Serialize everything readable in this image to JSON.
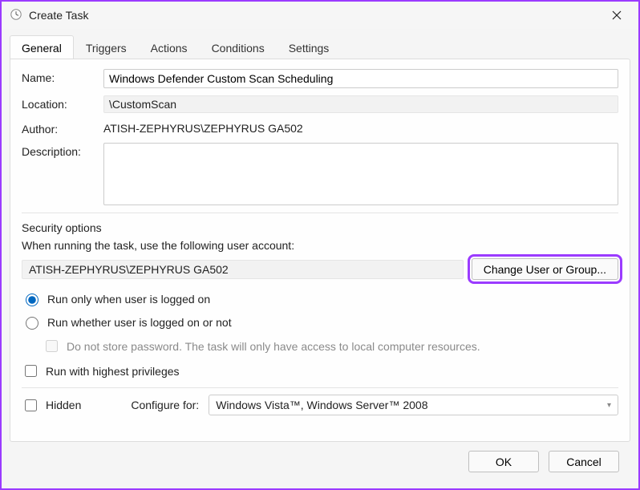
{
  "window": {
    "title": "Create Task"
  },
  "tabs": {
    "general": "General",
    "triggers": "Triggers",
    "actions": "Actions",
    "conditions": "Conditions",
    "settings": "Settings"
  },
  "form": {
    "name_label": "Name:",
    "name_value": "Windows Defender Custom Scan Scheduling",
    "location_label": "Location:",
    "location_value": "\\CustomScan",
    "author_label": "Author:",
    "author_value": "ATISH-ZEPHYRUS\\ZEPHYRUS GA502",
    "description_label": "Description:",
    "description_value": ""
  },
  "security": {
    "section_title": "Security options",
    "account_label": "When running the task, use the following user account:",
    "account_value": "ATISH-ZEPHYRUS\\ZEPHYRUS GA502",
    "change_user_btn": "Change User or Group...",
    "run_logged_on": "Run only when user is logged on",
    "run_whether": "Run whether user is logged on or not",
    "no_store_password": "Do not store password.  The task will only have access to local computer resources.",
    "highest_privileges": "Run with highest privileges"
  },
  "bottom": {
    "hidden_label": "Hidden",
    "configure_label": "Configure for:",
    "configure_value": "Windows Vista™, Windows Server™ 2008"
  },
  "buttons": {
    "ok": "OK",
    "cancel": "Cancel"
  }
}
